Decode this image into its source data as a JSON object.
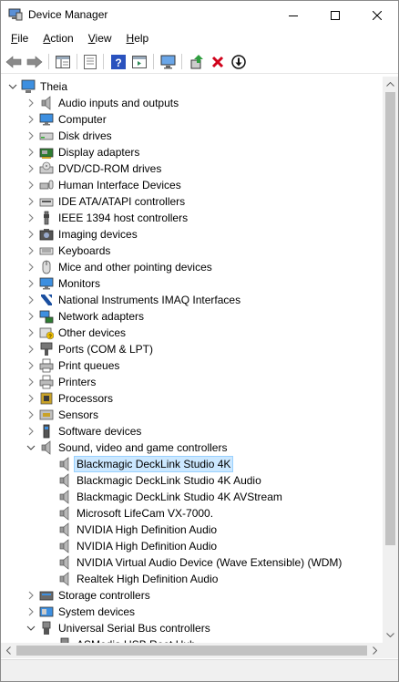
{
  "window": {
    "title": "Device Manager"
  },
  "menu": [
    {
      "label": "File",
      "u": "F",
      "rest": "ile"
    },
    {
      "label": "Action",
      "u": "A",
      "rest": "ction"
    },
    {
      "label": "View",
      "u": "V",
      "rest": "iew"
    },
    {
      "label": "Help",
      "u": "H",
      "rest": "elp"
    }
  ],
  "tree": {
    "root": "Theia",
    "categories": [
      {
        "label": "Audio inputs and outputs",
        "icon": "speaker-icon"
      },
      {
        "label": "Computer",
        "icon": "monitor-icon"
      },
      {
        "label": "Disk drives",
        "icon": "disk-drive-icon"
      },
      {
        "label": "Display adapters",
        "icon": "display-adapter-icon"
      },
      {
        "label": "DVD/CD-ROM drives",
        "icon": "dvd-drive-icon"
      },
      {
        "label": "Human Interface Devices",
        "icon": "hid-icon"
      },
      {
        "label": "IDE ATA/ATAPI controllers",
        "icon": "ide-controller-icon"
      },
      {
        "label": "IEEE 1394 host controllers",
        "icon": "firewire-icon"
      },
      {
        "label": "Imaging devices",
        "icon": "camera-icon"
      },
      {
        "label": "Keyboards",
        "icon": "keyboard-icon"
      },
      {
        "label": "Mice and other pointing devices",
        "icon": "mouse-icon"
      },
      {
        "label": "Monitors",
        "icon": "monitor-icon"
      },
      {
        "label": "National Instruments IMAQ Interfaces",
        "icon": "ni-icon"
      },
      {
        "label": "Network adapters",
        "icon": "network-icon"
      },
      {
        "label": "Other devices",
        "icon": "unknown-device-icon"
      },
      {
        "label": "Ports (COM & LPT)",
        "icon": "port-icon"
      },
      {
        "label": "Print queues",
        "icon": "printer-icon"
      },
      {
        "label": "Printers",
        "icon": "printer-icon"
      },
      {
        "label": "Processors",
        "icon": "processor-icon"
      },
      {
        "label": "Sensors",
        "icon": "sensor-icon"
      },
      {
        "label": "Software devices",
        "icon": "software-device-icon"
      },
      {
        "label": "Sound, video and game controllers",
        "icon": "speaker-icon",
        "expanded": true
      }
    ],
    "sound_children": [
      {
        "label": "Blackmagic DeckLink Studio 4K",
        "selected": true
      },
      {
        "label": "Blackmagic DeckLink Studio 4K Audio"
      },
      {
        "label": "Blackmagic DeckLink Studio 4K AVStream"
      },
      {
        "label": "Microsoft LifeCam VX-7000."
      },
      {
        "label": "NVIDIA High Definition Audio"
      },
      {
        "label": "NVIDIA High Definition Audio"
      },
      {
        "label": "NVIDIA Virtual Audio Device (Wave Extensible) (WDM)"
      },
      {
        "label": "Realtek High Definition Audio"
      }
    ],
    "after": [
      {
        "label": "Storage controllers",
        "icon": "storage-icon"
      },
      {
        "label": "System devices",
        "icon": "system-icon"
      },
      {
        "label": "Universal Serial Bus controllers",
        "icon": "usb-icon",
        "expanded": true
      }
    ],
    "usb_children_partial": [
      {
        "label": "ASMedia USB Root Hub"
      }
    ]
  },
  "colors": {
    "selection": "#cce8ff",
    "selection_border": "#99d1ff",
    "delete_red": "#d0021b",
    "help_blue": "#2a52be"
  }
}
